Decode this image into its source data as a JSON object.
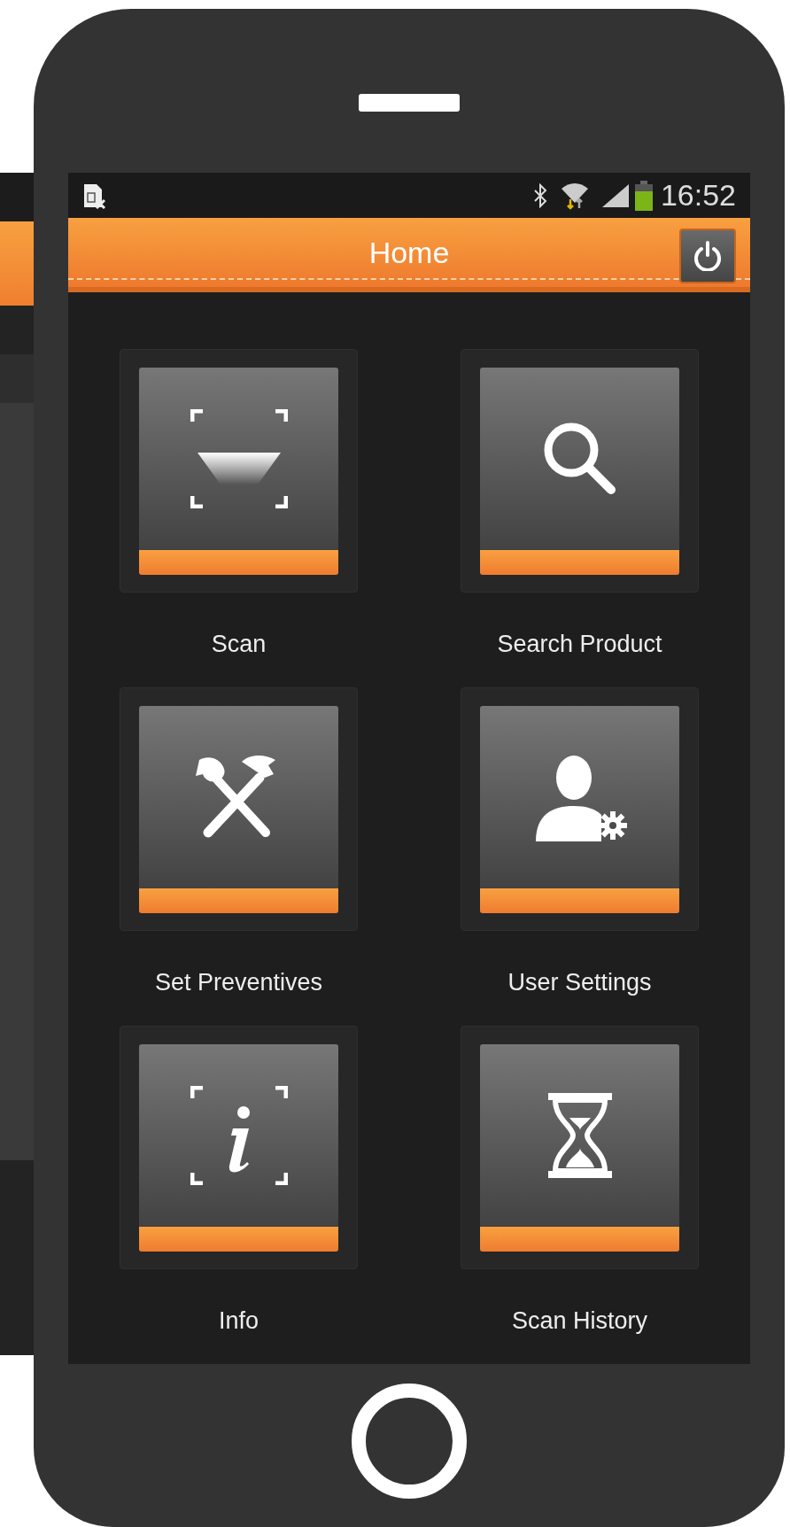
{
  "status_bar": {
    "time": "16:52"
  },
  "app_bar": {
    "title": "Home"
  },
  "tiles": [
    {
      "kind": "scan",
      "label": "Scan"
    },
    {
      "kind": "search",
      "label": "Search Product"
    },
    {
      "kind": "tools",
      "label": "Set Preventives"
    },
    {
      "kind": "user_settings",
      "label": "User Settings"
    },
    {
      "kind": "info",
      "label": "Info"
    },
    {
      "kind": "history",
      "label": "Scan History"
    }
  ]
}
